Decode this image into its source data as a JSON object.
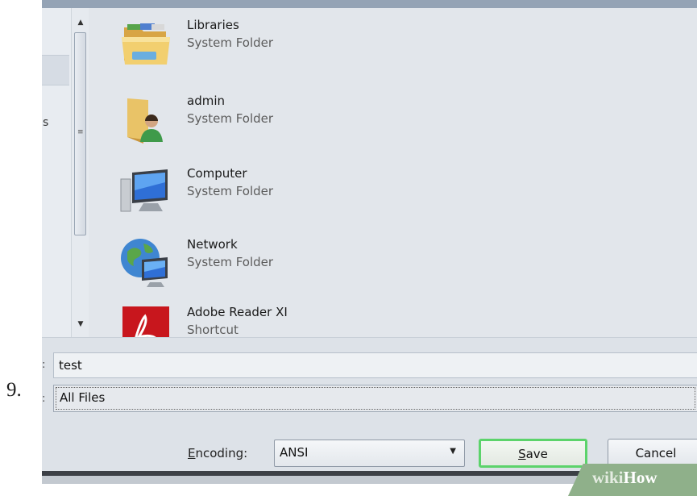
{
  "step_number": "9.",
  "nav_pane": {
    "clipped_label": "s"
  },
  "files": [
    {
      "name": "Libraries",
      "type": "System Folder",
      "icon": "libraries-folder-icon"
    },
    {
      "name": "admin",
      "type": "System Folder",
      "icon": "user-folder-icon"
    },
    {
      "name": "Computer",
      "type": "System Folder",
      "icon": "computer-icon"
    },
    {
      "name": "Network",
      "type": "System Folder",
      "icon": "network-icon"
    },
    {
      "name": "Adobe Reader XI",
      "type": "Shortcut",
      "icon": "adobe-reader-icon"
    }
  ],
  "form": {
    "filename_value": "test",
    "filetype_value": "All Files",
    "encoding_label_accel": "E",
    "encoding_label_rest": "ncoding:",
    "encoding_value": "ANSI",
    "save_accel": "S",
    "save_rest": "ave",
    "cancel_label": "Cancel"
  },
  "watermark": {
    "part1": "wiki",
    "part2": "How"
  },
  "colors": {
    "save_focus_border": "#5cd36b",
    "dialog_bg": "#dfe4ea"
  }
}
